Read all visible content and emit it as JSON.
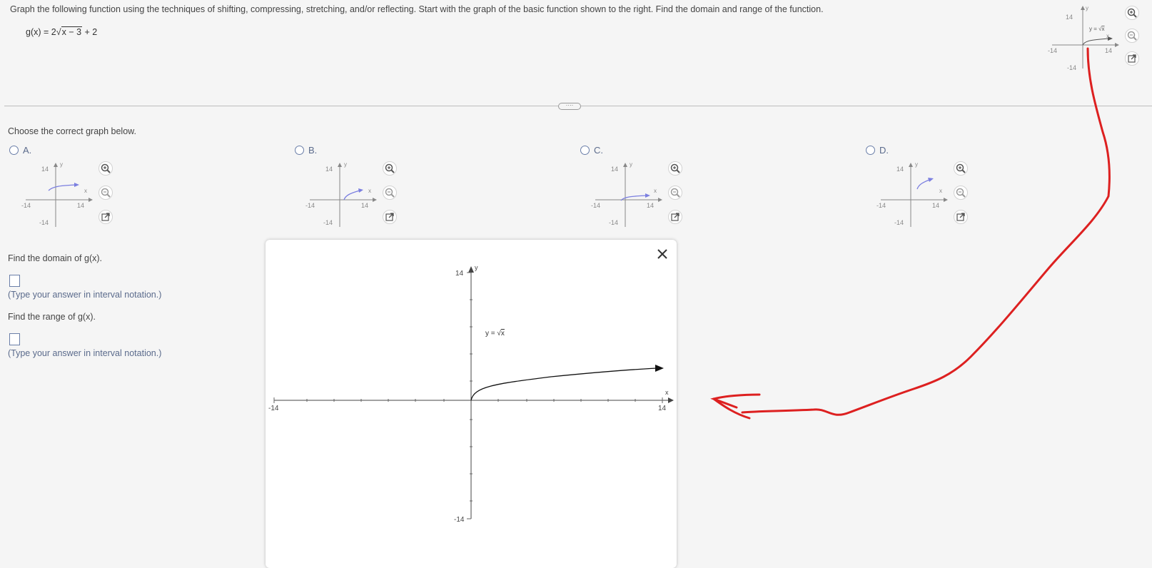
{
  "question": {
    "instruction": "Graph the following function using the techniques of shifting, compressing, stretching, and/or reflecting. Start with the graph of the basic function shown to the right. Find the domain and range of the function.",
    "func_prefix": "g(x) = 2",
    "func_radicand": "x − 3",
    "func_suffix": " + 2"
  },
  "basic_graph": {
    "y_top": "14",
    "y_bottom": "-14",
    "x_left": "-14",
    "x_right": "14",
    "x_axis": "x",
    "y_axis": "y",
    "curve_label_prefix": "y = ",
    "curve_label_radicand": "x"
  },
  "choose_prompt": "Choose the correct graph below.",
  "options": [
    {
      "letter": "A."
    },
    {
      "letter": "B."
    },
    {
      "letter": "C."
    },
    {
      "letter": "D."
    }
  ],
  "domain_prompt": "Find the domain of g(x).",
  "domain_hint": "(Type your answer in interval notation.)",
  "range_prompt": "Find the range of g(x).",
  "range_hint": "(Type your answer in interval notation.)",
  "colors": {
    "option_curve": "#7b7fe0",
    "annotation": "#e02020",
    "link": "#5b6b8c"
  },
  "icons": [
    "zoom-in-icon",
    "zoom-out-icon",
    "popout-icon",
    "close-icon"
  ]
}
